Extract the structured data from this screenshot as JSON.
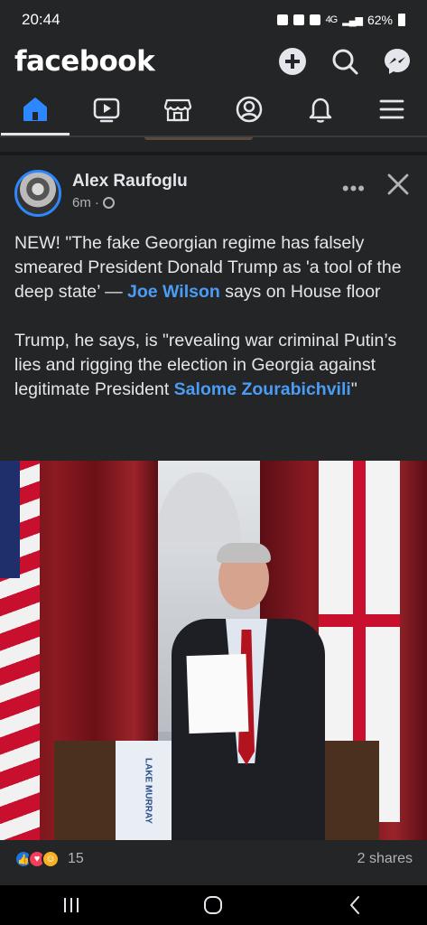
{
  "status_bar": {
    "time": "20:44",
    "network": "4G",
    "battery": "62%"
  },
  "header": {
    "logo": "facebook"
  },
  "nav": {
    "items": [
      {
        "name": "home",
        "active": true
      },
      {
        "name": "watch"
      },
      {
        "name": "marketplace"
      },
      {
        "name": "profile"
      },
      {
        "name": "notifications"
      },
      {
        "name": "menu"
      }
    ],
    "accent": "#2d88ff"
  },
  "post": {
    "author": "Alex Raufoglu",
    "time": "6m",
    "more_label": "•••",
    "text1_a": "NEW! \"The fake Georgian regime has falsely smeared President Donald Trump as  'a tool of the deep state’ — ",
    "text1_link": "Joe Wilson",
    "text1_b": " says on House floor",
    "text2_a": "Trump, he says, is \"revealing war criminal Putin’s lies and rigging the election in Georgia against legitimate President ",
    "text2_link": "Salome Zourabichvili",
    "text2_b": "\"",
    "banner_text": "LAKE MURRAY",
    "reaction_count": "15",
    "shares": "2 shares"
  }
}
